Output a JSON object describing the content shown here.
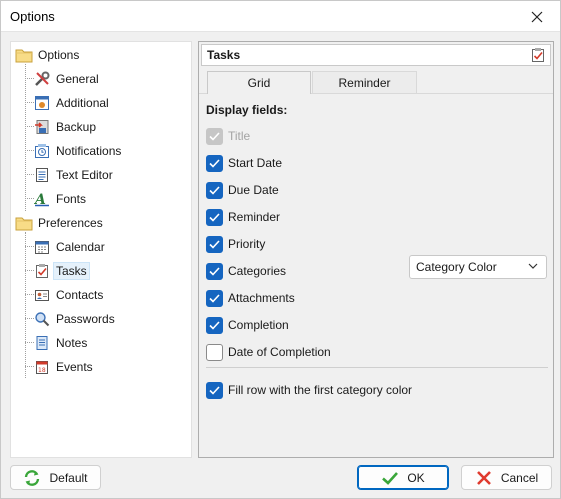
{
  "window": {
    "title": "Options"
  },
  "tree": {
    "groups": [
      {
        "label": "Options",
        "icon": "folder-icon",
        "items": [
          {
            "label": "General",
            "icon": "tools-icon"
          },
          {
            "label": "Additional",
            "icon": "settings-window-icon"
          },
          {
            "label": "Backup",
            "icon": "backup-icon"
          },
          {
            "label": "Notifications",
            "icon": "notifications-icon"
          },
          {
            "label": "Text Editor",
            "icon": "text-editor-icon"
          },
          {
            "label": "Fonts",
            "icon": "fonts-icon"
          }
        ]
      },
      {
        "label": "Preferences",
        "icon": "folder-icon",
        "items": [
          {
            "label": "Calendar",
            "icon": "calendar-icon"
          },
          {
            "label": "Tasks",
            "icon": "tasks-icon",
            "selected": true
          },
          {
            "label": "Contacts",
            "icon": "contacts-icon"
          },
          {
            "label": "Passwords",
            "icon": "passwords-icon"
          },
          {
            "label": "Notes",
            "icon": "notes-icon"
          },
          {
            "label": "Events",
            "icon": "events-icon"
          }
        ]
      }
    ]
  },
  "panel": {
    "title": "Tasks",
    "tabs": [
      {
        "label": "Grid",
        "active": true
      },
      {
        "label": "Reminder",
        "active": false
      }
    ],
    "section_label": "Display fields:",
    "fields": [
      {
        "label": "Title",
        "checked": true,
        "disabled": true
      },
      {
        "label": "Start Date",
        "checked": true
      },
      {
        "label": "Due Date",
        "checked": true
      },
      {
        "label": "Reminder",
        "checked": true
      },
      {
        "label": "Priority",
        "checked": true
      },
      {
        "label": "Categories",
        "checked": true
      },
      {
        "label": "Attachments",
        "checked": true
      },
      {
        "label": "Completion",
        "checked": true
      },
      {
        "label": "Date of Completion",
        "checked": false
      }
    ],
    "category_select": {
      "value": "Category Color"
    },
    "fill_row": {
      "label": "Fill row with the first category color",
      "checked": true
    }
  },
  "footer": {
    "default_label": "Default",
    "ok_label": "OK",
    "cancel_label": "Cancel"
  },
  "colors": {
    "accent": "#1565c0",
    "ok_green": "#3aa63a",
    "cancel_red": "#e03a2e"
  }
}
